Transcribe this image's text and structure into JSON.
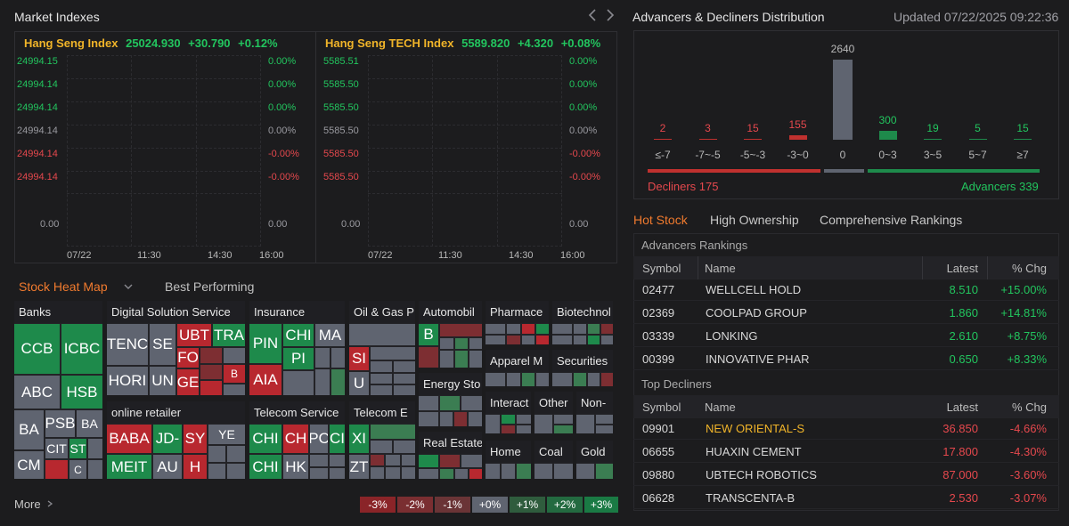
{
  "market": {
    "title": "Market Indexes",
    "prev_icon": "chevron-left-icon",
    "next_icon": "chevron-right-icon",
    "indexes": [
      {
        "name": "Hang Seng Index",
        "value": "25024.930",
        "change": "+30.790",
        "pct": "+0.12%",
        "left_ticks": [
          "24994.15",
          "24994.14",
          "24994.14",
          "24994.14",
          "24994.14",
          "24994.14"
        ],
        "right_ticks": [
          "0.00%",
          "0.00%",
          "0.00%",
          "0.00%",
          "-0.00%",
          "-0.00%"
        ],
        "vol_left": "0.00",
        "vol_right": "0.00",
        "x_ticks": [
          "07/22",
          "11:30",
          "14:30",
          "16:00"
        ]
      },
      {
        "name": "Hang Seng TECH Index",
        "value": "5589.820",
        "change": "+4.320",
        "pct": "+0.08%",
        "left_ticks": [
          "5585.51",
          "5585.50",
          "5585.50",
          "5585.50",
          "5585.50",
          "5585.50"
        ],
        "right_ticks": [
          "0.00%",
          "0.00%",
          "0.00%",
          "0.00%",
          "-0.00%",
          "-0.00%"
        ],
        "vol_left": "0.00",
        "vol_right": "0.00",
        "x_ticks": [
          "07/22",
          "11:30",
          "14:30",
          "16:00"
        ]
      }
    ]
  },
  "heatmap": {
    "tab_active": "Stock Heat Map",
    "tab_other": "Best Performing",
    "dropdown_icon": "chevron-down-icon",
    "sectors": {
      "banks": "Banks",
      "digital": "Digital Solution Service",
      "insurance": "Insurance",
      "oil": "Oil & Gas P",
      "auto": "Automobil",
      "pharma": "Pharmace",
      "biotech": "Biotechnol",
      "apparel": "Apparel M",
      "securities": "Securities",
      "online": "online retailer",
      "telecom_svc": "Telecom Service",
      "telecom_e": "Telecom E",
      "energy": "Energy Sto",
      "interact": "Interact",
      "other": "Other",
      "non": "Non-",
      "real_estate": "Real Estate",
      "home": "Home",
      "coal": "Coal",
      "gold": "Gold"
    },
    "tiles": {
      "ccb": "CCB",
      "icbc": "ICBC",
      "abc": "ABC",
      "hsb": "HSB",
      "ba": "BA",
      "psb": "PSB",
      "ba2": "BA",
      "cit": "CIT",
      "st": "ST",
      "cm": "CM",
      "c": "C",
      "tenc": "TENC",
      "se": "SE",
      "ubt": "UBT",
      "tra": "TRA",
      "fo": "FO",
      "hori": "HORI",
      "un": "UN",
      "ge": "GE",
      "b": "B",
      "pin": "PIN",
      "chi": "CHI",
      "ma": "MA",
      "pi": "PI",
      "aia": "AIA",
      "si": "SI",
      "u": "U",
      "auto_b": "B",
      "baba": "BABA",
      "jd": "JD-",
      "sy": "SY",
      "ye": "YE",
      "meit": "MEIT",
      "au": "AU",
      "h": "H",
      "tchi1": "CHI",
      "tch": "CH",
      "pc": "PC",
      "ci": "CI",
      "tchi2": "CHI",
      "hk": "HK",
      "xi": "XI",
      "zt": "ZT"
    },
    "more": "More",
    "legend": [
      "-3%",
      "-2%",
      "-1%",
      "+0%",
      "+1%",
      "+2%",
      "+3%"
    ]
  },
  "distribution": {
    "title": "Advancers & Decliners Distribution",
    "updated": "Updated 07/22/2025 09:22:36",
    "buckets": [
      {
        "label": "≤-7",
        "count": 2
      },
      {
        "label": "-7~-5",
        "count": 3
      },
      {
        "label": "-5~-3",
        "count": 15
      },
      {
        "label": "-3~0",
        "count": 155
      },
      {
        "label": "0",
        "count": 2640
      },
      {
        "label": "0~3",
        "count": 300
      },
      {
        "label": "3~5",
        "count": 19
      },
      {
        "label": "5~7",
        "count": 5
      },
      {
        "label": "≥7",
        "count": 15
      }
    ],
    "decliners": "Decliners 175",
    "advancers": "Advancers 339"
  },
  "hot": {
    "tabs": [
      "Hot Stock",
      "High Ownership",
      "Comprehensive Rankings"
    ],
    "adv_title": "Advancers Rankings",
    "dec_title": "Top Decliners",
    "cols": {
      "symbol": "Symbol",
      "name": "Name",
      "latest": "Latest",
      "chg": "% Chg"
    },
    "advancers": [
      {
        "symbol": "02477",
        "name": "WELLCELL HOLD",
        "latest": "8.510",
        "chg": "+15.00%"
      },
      {
        "symbol": "02369",
        "name": "COOLPAD GROUP",
        "latest": "1.860",
        "chg": "+14.81%"
      },
      {
        "symbol": "03339",
        "name": "LONKING",
        "latest": "2.610",
        "chg": "+8.75%"
      },
      {
        "symbol": "00399",
        "name": "INNOVATIVE PHAR",
        "latest": "0.650",
        "chg": "+8.33%"
      }
    ],
    "decliners": [
      {
        "symbol": "09901",
        "name": "NEW ORIENTAL-S",
        "latest": "36.850",
        "chg": "-4.66%"
      },
      {
        "symbol": "06655",
        "name": "HUAXIN CEMENT",
        "latest": "17.800",
        "chg": "-4.30%"
      },
      {
        "symbol": "09880",
        "name": "UBTECH ROBOTICS",
        "latest": "87.000",
        "chg": "-3.60%"
      },
      {
        "symbol": "06628",
        "name": "TRANSCENTA-B",
        "latest": "2.530",
        "chg": "-3.07%"
      }
    ]
  }
}
